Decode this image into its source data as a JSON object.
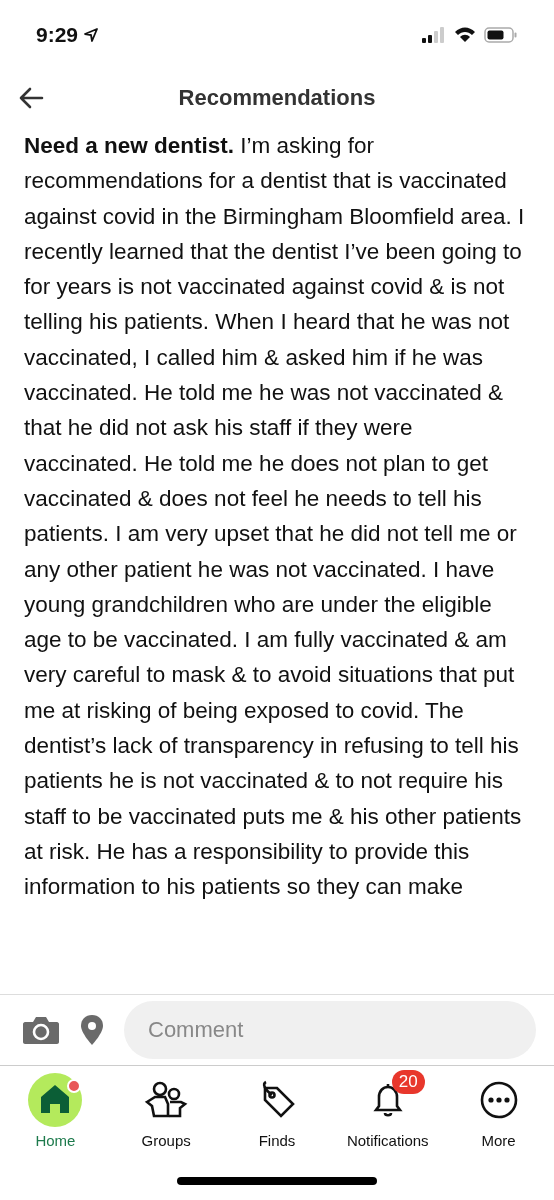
{
  "status_bar": {
    "time": "9:29"
  },
  "header": {
    "title": "Recommendations"
  },
  "post": {
    "text": "**Need a new dentist.** I’m asking for recommendations for a dentist that is vaccinated against covid in the Birmingham Bloomfield area. I recently learned that the dentist I’ve been going to for years is not vaccinated against covid & is not telling his patients. When I heard that he was not vaccinated, I called him & asked him if he was vaccinated. He told me he was not vaccinated & that he did not ask his staff if they were vaccinated. He told me he does not plan to get vaccinated & does not feel he needs to tell his patients. I am very upset that he did not tell me or any other patient he was not vaccinated. I have young grandchildren who are under the eligible age to be vaccinated. I am fully vaccinated & am very careful to mask & to avoid situations that put me at risking of being exposed to covid. The dentist’s lack of transparency in refusing to tell his patients he is not vaccinated & to not require his staff to be vaccinated puts me & his other patients at risk. He has a responsibility to provide this information to his patients so they can make"
  },
  "comment_bar": {
    "placeholder": "Comment"
  },
  "nav": [
    {
      "kind": "home",
      "label": "Home",
      "selected": true,
      "dot": true
    },
    {
      "kind": "groups",
      "label": "Groups",
      "selected": false,
      "dot": false
    },
    {
      "kind": "finds",
      "label": "Finds",
      "selected": false,
      "dot": false
    },
    {
      "kind": "notifications",
      "label": "Notifications",
      "selected": false,
      "dot": false,
      "badge": "20"
    },
    {
      "kind": "more",
      "label": "More",
      "selected": false,
      "dot": false
    }
  ]
}
